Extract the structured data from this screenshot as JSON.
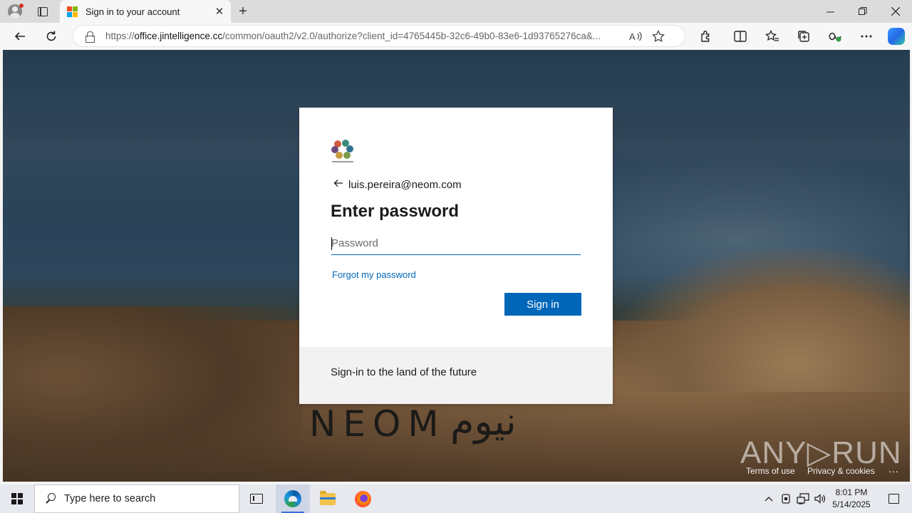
{
  "browser": {
    "tab_title": "Sign in to your account",
    "url_host": "office.jintelligence.cc",
    "url_scheme": "https://",
    "url_path": "/common/oauth2/v2.0/authorize?client_id=4765445b-32c6-49b0-83e6-1d93765276ca&...",
    "new_tab_symbol": "+",
    "close_tab_symbol": "✕"
  },
  "signin": {
    "org_logo_label": "NEOM",
    "identity": "luis.pereira@neom.com",
    "title": "Enter password",
    "password_placeholder": "Password",
    "forgot_link": "Forgot my password",
    "signin_button": "Sign in",
    "footer_text": "Sign-in to the land of the future"
  },
  "page": {
    "watermark_latin": "NEOM",
    "watermark_arabic": "نيوم",
    "terms_link": "Terms of use",
    "privacy_link": "Privacy & cookies",
    "more_options": "...",
    "overlay_brand": "ANY▷RUN"
  },
  "taskbar": {
    "search_placeholder": "Type here to search",
    "time": "8:01 PM",
    "date": "5/14/2025"
  },
  "colors": {
    "accent_blue": "#0067b8",
    "ms_red": "#f25022",
    "ms_green": "#7fba00",
    "ms_blue": "#00a4ef",
    "ms_yellow": "#ffb900"
  }
}
